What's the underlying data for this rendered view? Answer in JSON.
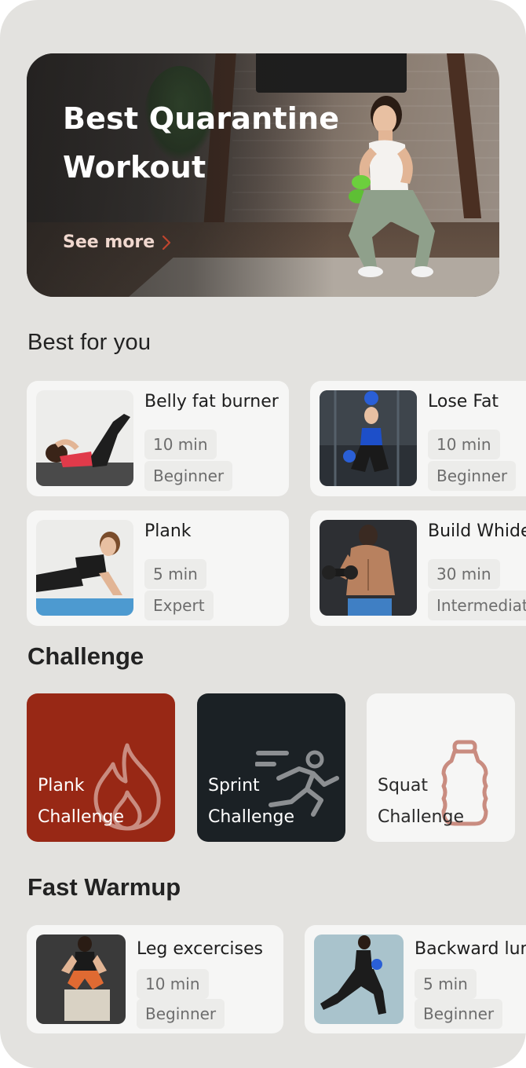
{
  "hero": {
    "title": "Best Quarantine Workout",
    "link": "See more"
  },
  "sections": {
    "best_for_you": "Best for you",
    "challenge": "Challenge",
    "fast_warmup": "Fast Warmup"
  },
  "best_for_you": [
    {
      "title": "Belly fat burner",
      "duration": "10 min",
      "level": "Beginner"
    },
    {
      "title": "Lose Fat",
      "duration": "10 min",
      "level": "Beginner"
    },
    {
      "title": "Plank",
      "duration": "5 min",
      "level": "Expert"
    },
    {
      "title": "Build Whide",
      "duration": "30 min",
      "level": "Intermediat"
    }
  ],
  "challenges": [
    {
      "line1": "Plank",
      "line2": "Challenge",
      "icon": "flame-icon",
      "color": "#982815"
    },
    {
      "line1": "Sprint",
      "line2": "Challenge",
      "icon": "runner-icon",
      "color": "#1b2125"
    },
    {
      "line1": "Squat",
      "line2": "Challenge",
      "icon": "water-bottle-icon",
      "color": "#f6f6f5"
    }
  ],
  "fast_warmup": [
    {
      "title": "Leg excercises",
      "duration": "10 min",
      "level": "Beginner"
    },
    {
      "title": "Backward lun",
      "duration": "5 min",
      "level": "Beginner"
    }
  ],
  "colors": {
    "background": "#e3e2df",
    "card": "#f6f6f5",
    "chip": "#ececea",
    "accent_red": "#982815",
    "dark_tile": "#1b2125",
    "icon_rose": "#c98c80"
  }
}
